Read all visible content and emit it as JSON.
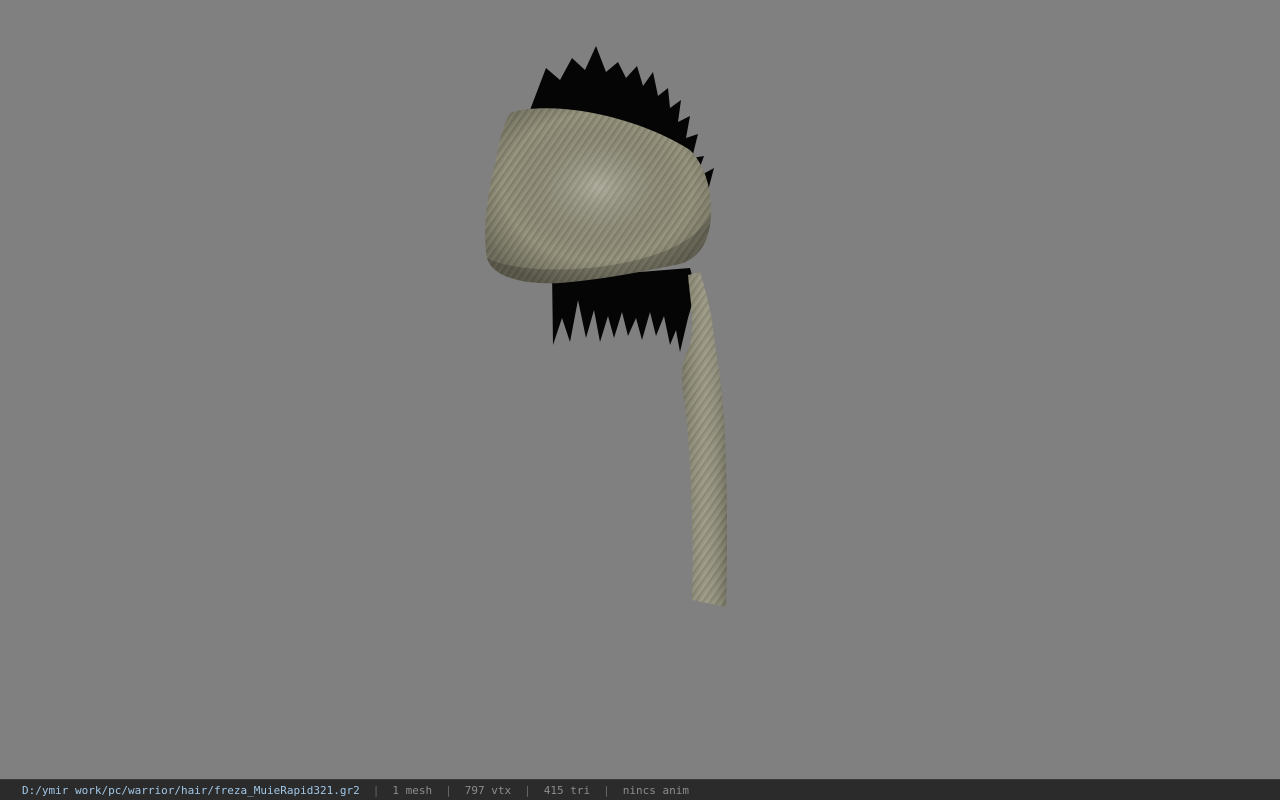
{
  "viewport": {
    "background": "#808080",
    "model_description_icon": "hair-bandana-model"
  },
  "status_bar": {
    "file_path": "D:/ymir work/pc/warrior/hair/freza_MuieRapid321.gr2",
    "separator": "|",
    "mesh_count": "1 mesh",
    "vertex_count": "797 vtx",
    "triangle_count": "415 tri",
    "animation": "nincs anim"
  },
  "colors": {
    "path_text": "#9fc6e6",
    "stats_text": "#8c8c8c",
    "status_bg": "#2b2b2b"
  }
}
